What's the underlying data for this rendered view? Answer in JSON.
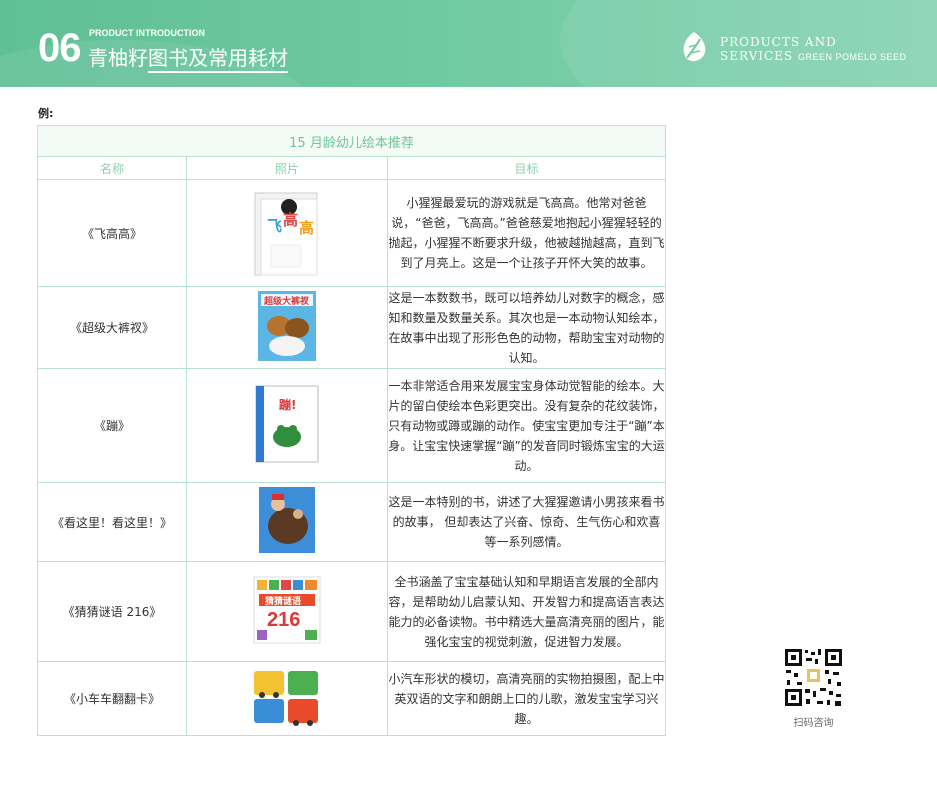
{
  "header": {
    "section_number": "06",
    "section_en": "PRODUCT INTRODUCTION",
    "section_zh_prefix": "青柚籽",
    "section_zh_underlined": "图书及常用耗材",
    "brand_line1": "PRODUCTS AND",
    "brand_line2": "SERVICES",
    "brand_line2_small": "GREEN POMELO SEED",
    "colors": {
      "banner": "#6fc9a1",
      "text": "#ffffff"
    }
  },
  "example_label": "例:",
  "table": {
    "title": "15 月龄幼儿绘本推荐",
    "columns": [
      "名称",
      "照片",
      "目标"
    ],
    "rows": [
      {
        "name": "《飞高高》",
        "cover_icon": "book-cover-fei-gao-gao",
        "goal": "小猩猩最爱玩的游戏就是飞高高。他常对爸爸说，“爸爸，飞高高。”爸爸慈爱地抱起小猩猩轻轻的抛起，小猩猩不断要求升级，他被越抛越高，直到飞到了月亮上。这是一个让孩子开怀大笑的故事。"
      },
      {
        "name": "《超级大裤衩》",
        "cover_icon": "book-cover-chao-ji-da-ku-cha",
        "goal": "这是一本数数书，既可以培养幼儿对数字的概念，感知和数量及数量关系。其次也是一本动物认知绘本， 在故事中出现了形形色色的动物，帮助宝宝对动物的认知。"
      },
      {
        "name": "《蹦》",
        "cover_icon": "book-cover-beng",
        "goal": "一本非常适合用来发展宝宝身体动觉智能的绘本。大片的留白使绘本色彩更突出。没有复杂的花纹装饰，只有动物或蹲或蹦的动作。使宝宝更加专注于“蹦”本身。让宝宝快速掌握“蹦”的发音同时锻炼宝宝的大运动。"
      },
      {
        "name": "《看这里！看这里！》",
        "cover_icon": "book-cover-kan-zhe-li",
        "goal": "这是一本特别的书，讲述了大猩猩邀请小男孩来看书的故事， 但却表达了兴奋、惊奇、生气伤心和欢喜等一系列感情。"
      },
      {
        "name": "《猜猜谜语 216》",
        "cover_icon": "book-cover-cai-cai-mi-yu",
        "goal": "全书涵盖了宝宝基础认知和早期语言发展的全部内容，是帮助幼儿启蒙认知、开发智力和提高语言表达能力的必备读物。书中精选大量高清亮丽的图片，能强化宝宝的视觉刺激，促进智力发展。"
      },
      {
        "name": "《小车车翻翻卡》",
        "cover_icon": "book-cover-xiao-che-che",
        "goal": "小汽车形状的模切，高清亮丽的实物拍摄图，配上中英双语的文字和朗朗上口的儿歌，激发宝宝学习兴趣。"
      }
    ]
  },
  "qr": {
    "label": "扫码咨询"
  }
}
